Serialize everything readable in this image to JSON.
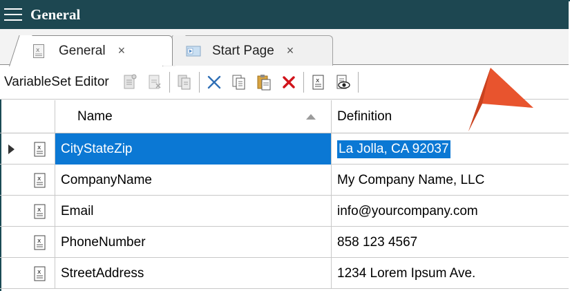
{
  "window": {
    "title": "General"
  },
  "tabs": [
    {
      "label": "General",
      "close": "×",
      "active": true,
      "icon": "variable-doc-icon"
    },
    {
      "label": "Start Page",
      "close": "×",
      "active": false,
      "icon": "start-page-icon"
    }
  ],
  "toolbar": {
    "label": "VariableSet Editor",
    "buttons": [
      "new-variable-icon",
      "new-variable-disabled-icon",
      "duplicate-variable-icon",
      "cut-icon",
      "copy-icon",
      "paste-icon",
      "delete-icon",
      "edit-variable-icon",
      "preview-icon"
    ]
  },
  "grid": {
    "columns": {
      "name": "Name",
      "definition": "Definition"
    },
    "rows": [
      {
        "name": "CityStateZip",
        "definition": "La Jolla, CA 92037",
        "selected": true
      },
      {
        "name": "CompanyName",
        "definition": "My Company Name, LLC",
        "selected": false
      },
      {
        "name": "Email",
        "definition": "info@yourcompany.com",
        "selected": false
      },
      {
        "name": "PhoneNumber",
        "definition": "858 123 4567",
        "selected": false
      },
      {
        "name": "StreetAddress",
        "definition": "1234 Lorem Ipsum Ave.",
        "selected": false
      }
    ]
  },
  "colors": {
    "titlebar": "#1d4751",
    "selection": "#0b78d4",
    "callout": "#e8542e",
    "delete": "#d1141b"
  }
}
